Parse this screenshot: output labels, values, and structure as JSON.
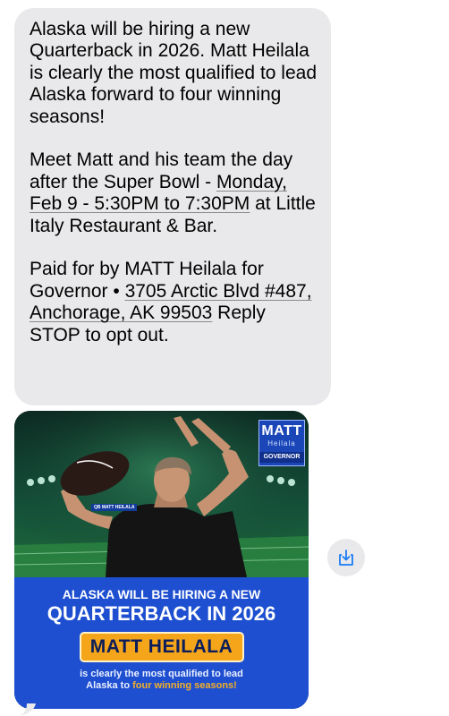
{
  "message": {
    "p1": "Alaska will be hiring a new Quarterback in 2026.  Matt Heilala is clearly the most qualified to lead Alaska forward to four winning seasons!",
    "p2_prefix": "Meet Matt and his team the day after the Super Bowl - ",
    "p2_link": "Monday, Feb 9 - 5:30PM to 7:30PM",
    "p2_suffix": " at Little Italy Restaurant & Bar.",
    "p3_prefix": "Paid for by MATT Heilala for Governor • ",
    "p3_link": "3705 Arctic Blvd #487, Anchorage, AK 99503",
    "p3_suffix": " Reply STOP to opt out."
  },
  "ad_image": {
    "logo": {
      "line1": "MATT",
      "line2": "Heilala",
      "line3": "GOVERNOR"
    },
    "jersey_tag": "QB MATT HEILALA",
    "headline1": "ALASKA WILL BE HIRING A NEW",
    "headline2": "QUARTERBACK IN 2026",
    "name": "MATT HEILALA",
    "tagline1": "is clearly the most qualified to lead",
    "tagline2_prefix": "Alaska to ",
    "tagline2_accent": "four winning seasons!"
  },
  "icons": {
    "save": "download-icon"
  },
  "colors": {
    "bubble": "#e9e9eb",
    "banner": "#1e4fd0",
    "accent": "#f5a51a",
    "icon": "#1a7cf5"
  }
}
